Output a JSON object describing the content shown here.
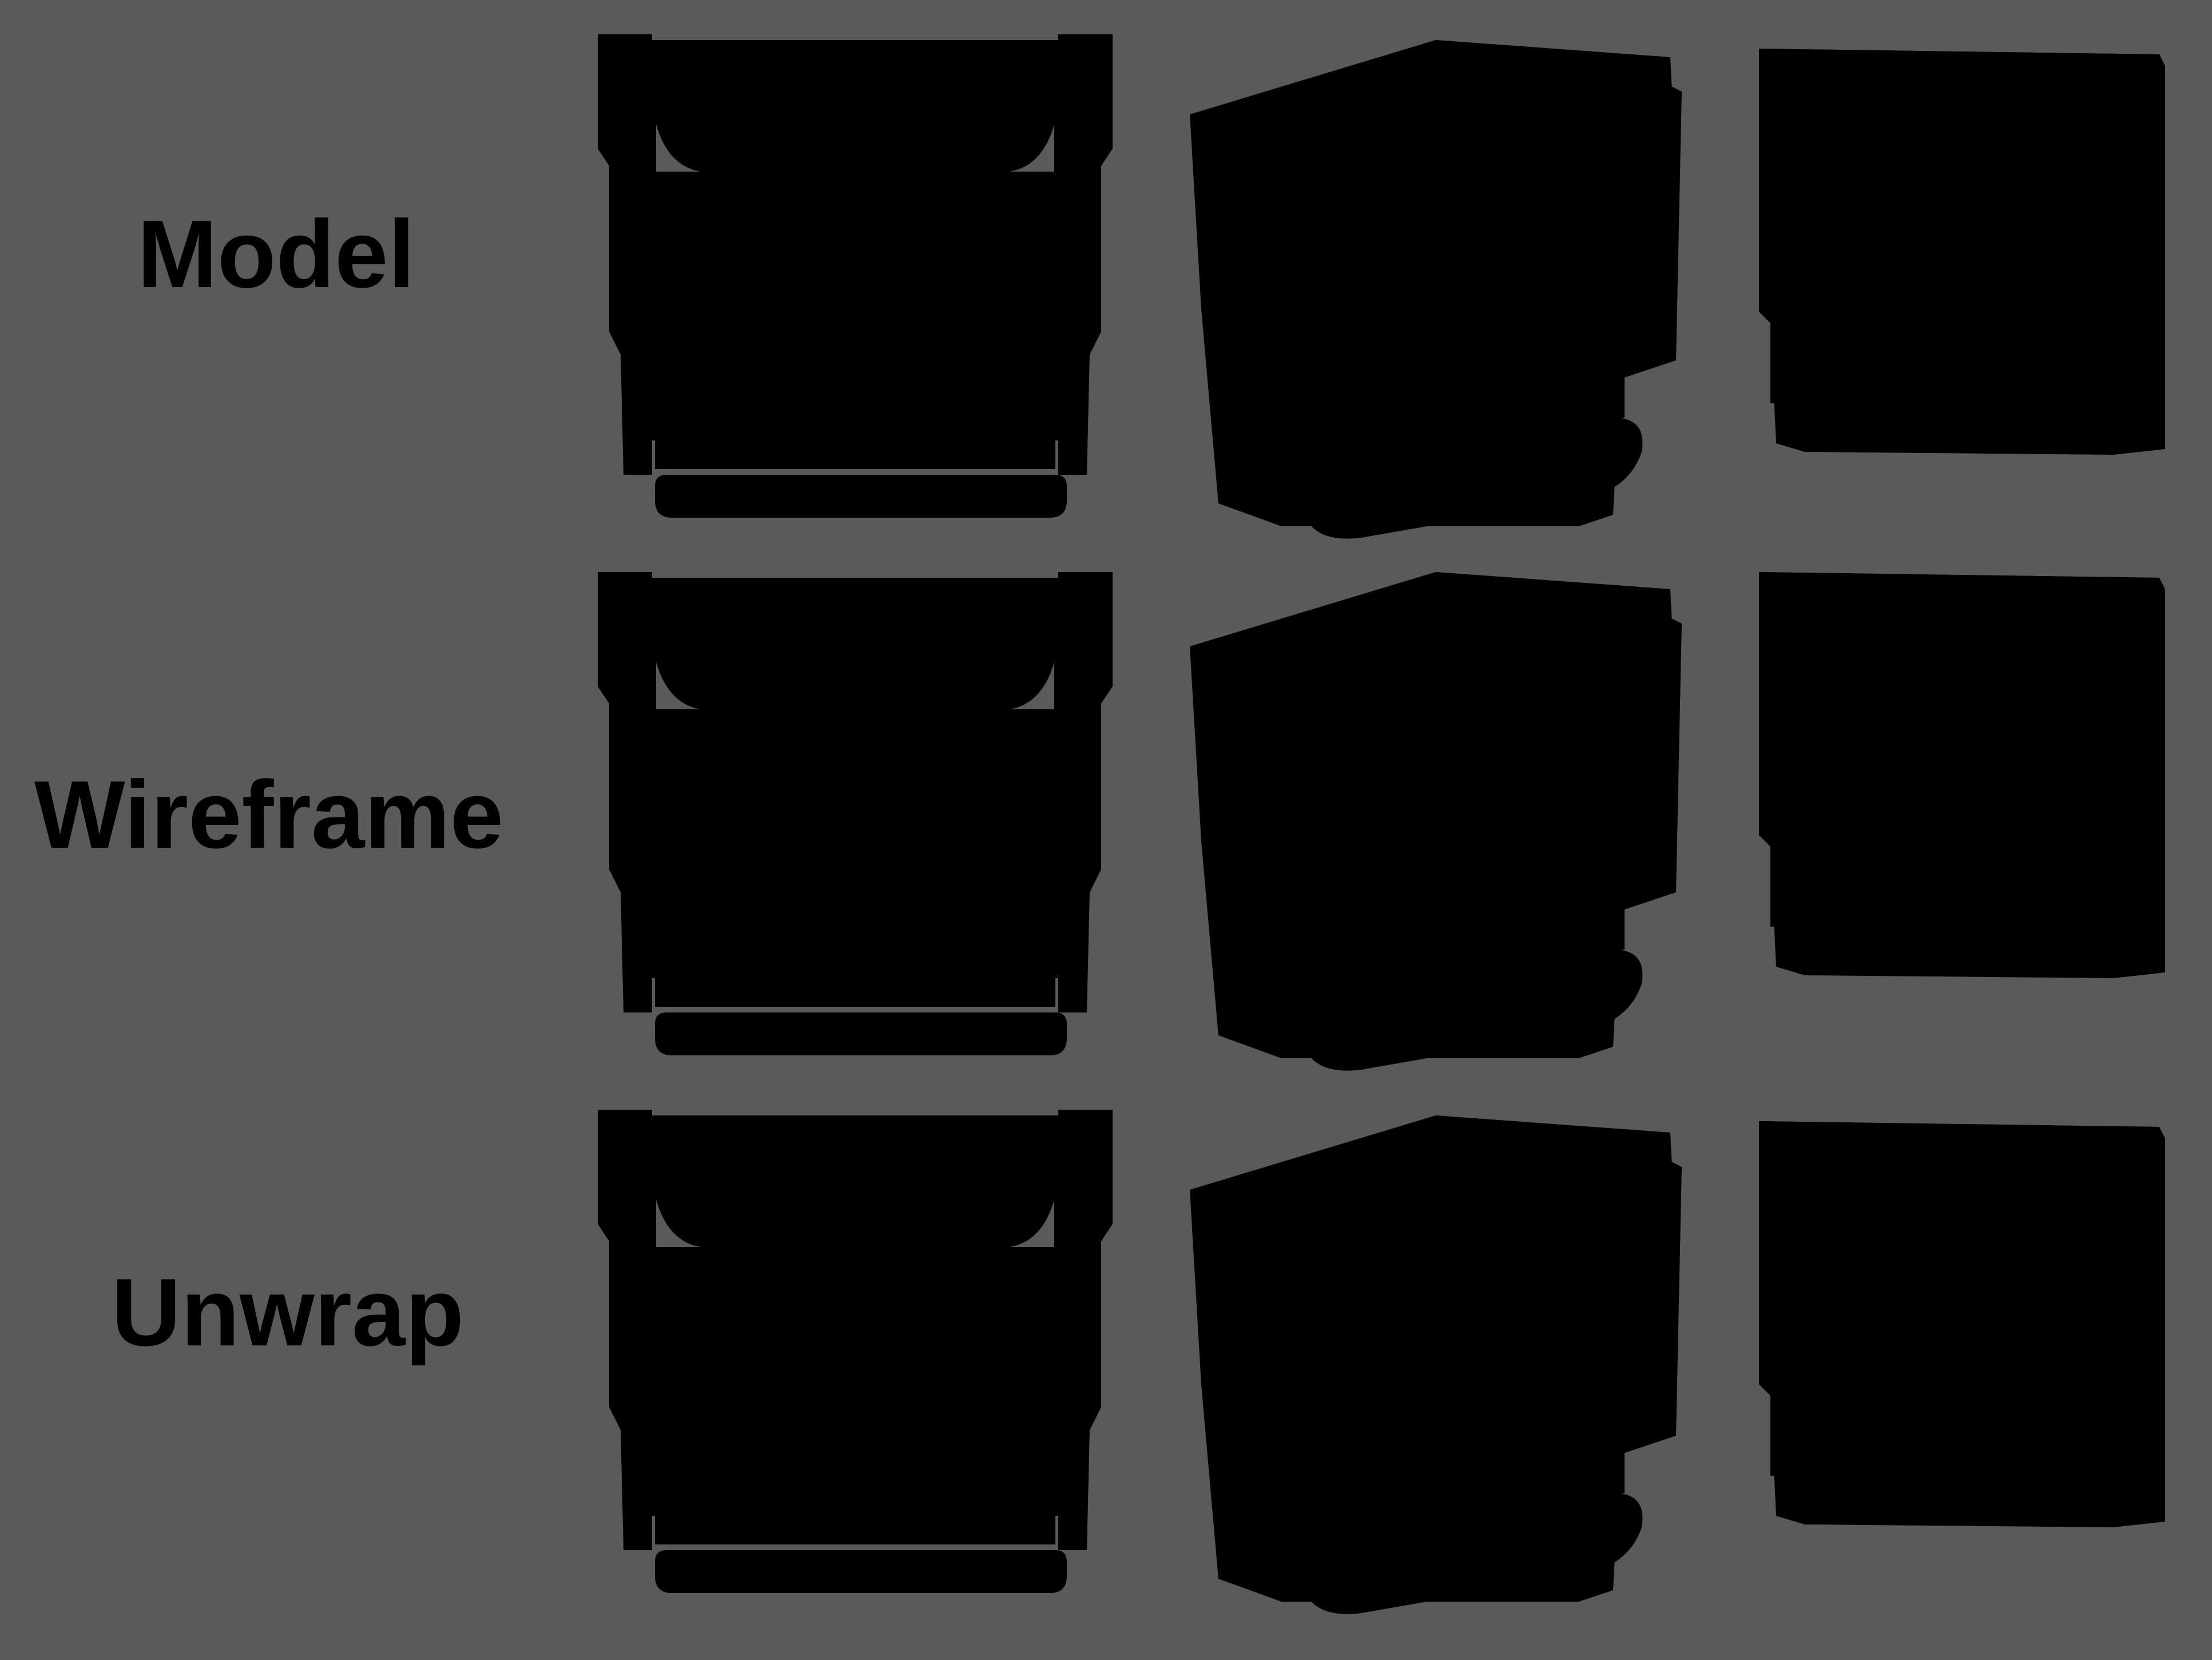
{
  "rows": [
    {
      "label": "Model"
    },
    {
      "label": "Wireframe"
    },
    {
      "label": "Unwrap"
    }
  ],
  "colors": {
    "background": "#5a5a5a",
    "model_gray": "#c8c8c8",
    "wire_blue": "#2a2a9a",
    "checker_red": "#e06a6a",
    "checker_dark": "#1e1e1e"
  }
}
